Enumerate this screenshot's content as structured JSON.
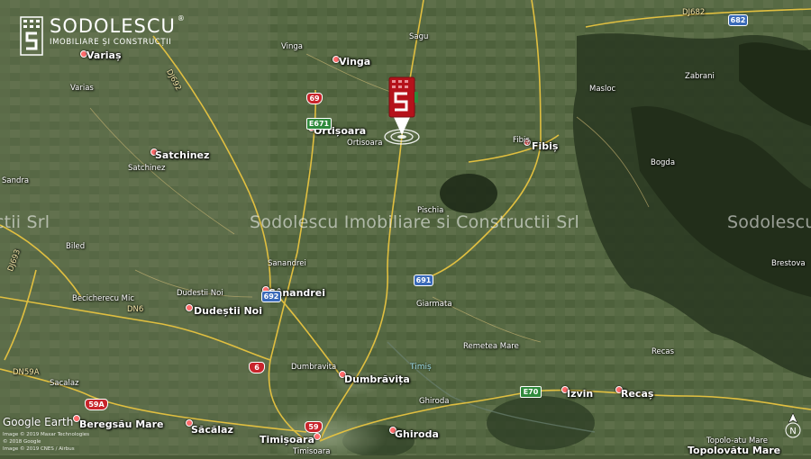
{
  "branding": {
    "name": "SODOLESCU",
    "subtitle": "IMOBILIARE ȘI CONSTRUCȚII",
    "registered": "®"
  },
  "watermarks": [
    "ctii Srl",
    "Sodolescu Imobiliare si Constructii Srl",
    "Sodolescu"
  ],
  "places": [
    {
      "name": "Variaș",
      "kind": "town"
    },
    {
      "name": "Varias",
      "kind": "small"
    },
    {
      "name": "Vinga",
      "kind": "small"
    },
    {
      "name": "Vinga",
      "kind": "town"
    },
    {
      "name": "Sagu",
      "kind": "small"
    },
    {
      "name": "Ortișoara",
      "kind": "town"
    },
    {
      "name": "Ortisoara",
      "kind": "small"
    },
    {
      "name": "Satchinez",
      "kind": "town"
    },
    {
      "name": "Satchinez",
      "kind": "small"
    },
    {
      "name": "Sandra",
      "kind": "small"
    },
    {
      "name": "Biled",
      "kind": "small"
    },
    {
      "name": "Fibiș",
      "kind": "town"
    },
    {
      "name": "Fibiș",
      "kind": "small"
    },
    {
      "name": "Masloc",
      "kind": "small"
    },
    {
      "name": "Zabrani",
      "kind": "small"
    },
    {
      "name": "Bogda",
      "kind": "small"
    },
    {
      "name": "Pischia",
      "kind": "small"
    },
    {
      "name": "Brestova",
      "kind": "small"
    },
    {
      "name": "Sanandrei",
      "kind": "small"
    },
    {
      "name": "Sânandrei",
      "kind": "town"
    },
    {
      "name": "Dudestii Noi",
      "kind": "small"
    },
    {
      "name": "Dudeștii Noi",
      "kind": "town"
    },
    {
      "name": "Becicherecu Mic",
      "kind": "small"
    },
    {
      "name": "Giarmata",
      "kind": "small"
    },
    {
      "name": "Remetea Mare",
      "kind": "small"
    },
    {
      "name": "Recas",
      "kind": "small"
    },
    {
      "name": "Izvin",
      "kind": "town"
    },
    {
      "name": "Recaș",
      "kind": "town"
    },
    {
      "name": "Dumbravita",
      "kind": "small"
    },
    {
      "name": "Dumbrăvița",
      "kind": "town"
    },
    {
      "name": "Ghiroda",
      "kind": "small"
    },
    {
      "name": "Ghiroda",
      "kind": "town"
    },
    {
      "name": "Sacalaz",
      "kind": "small"
    },
    {
      "name": "Săcălaz",
      "kind": "town"
    },
    {
      "name": "Beregsău Mare",
      "kind": "town"
    },
    {
      "name": "Timișoara",
      "kind": "town"
    },
    {
      "name": "Timisoara",
      "kind": "small"
    },
    {
      "name": "Topolovătu Mare",
      "kind": "town"
    },
    {
      "name": "Topolo-atu Mare",
      "kind": "small"
    }
  ],
  "water_labels": [
    "Timiș"
  ],
  "road_labels": [
    "DJ682",
    "DJ693",
    "DJ692",
    "DN6",
    "DN59A"
  ],
  "shields": [
    {
      "text": "69",
      "color": "red"
    },
    {
      "text": "E671",
      "color": "green"
    },
    {
      "text": "682",
      "color": "blue"
    },
    {
      "text": "692",
      "color": "blue"
    },
    {
      "text": "691",
      "color": "blue"
    },
    {
      "text": "6",
      "color": "red"
    },
    {
      "text": "59A",
      "color": "red"
    },
    {
      "text": "59",
      "color": "red"
    },
    {
      "text": "E70",
      "color": "green"
    }
  ],
  "attribution": {
    "provider": "Google Earth",
    "credits": [
      "Image © 2019 Maxar Technologies",
      "© 2018 Google",
      "Image © 2019 CNES / Airbus"
    ],
    "compass": "N"
  },
  "colors": {
    "road": "#e8c440",
    "marker": "#b5121b",
    "label": "#ffffff",
    "terrain_dark": "#2c3a22"
  }
}
